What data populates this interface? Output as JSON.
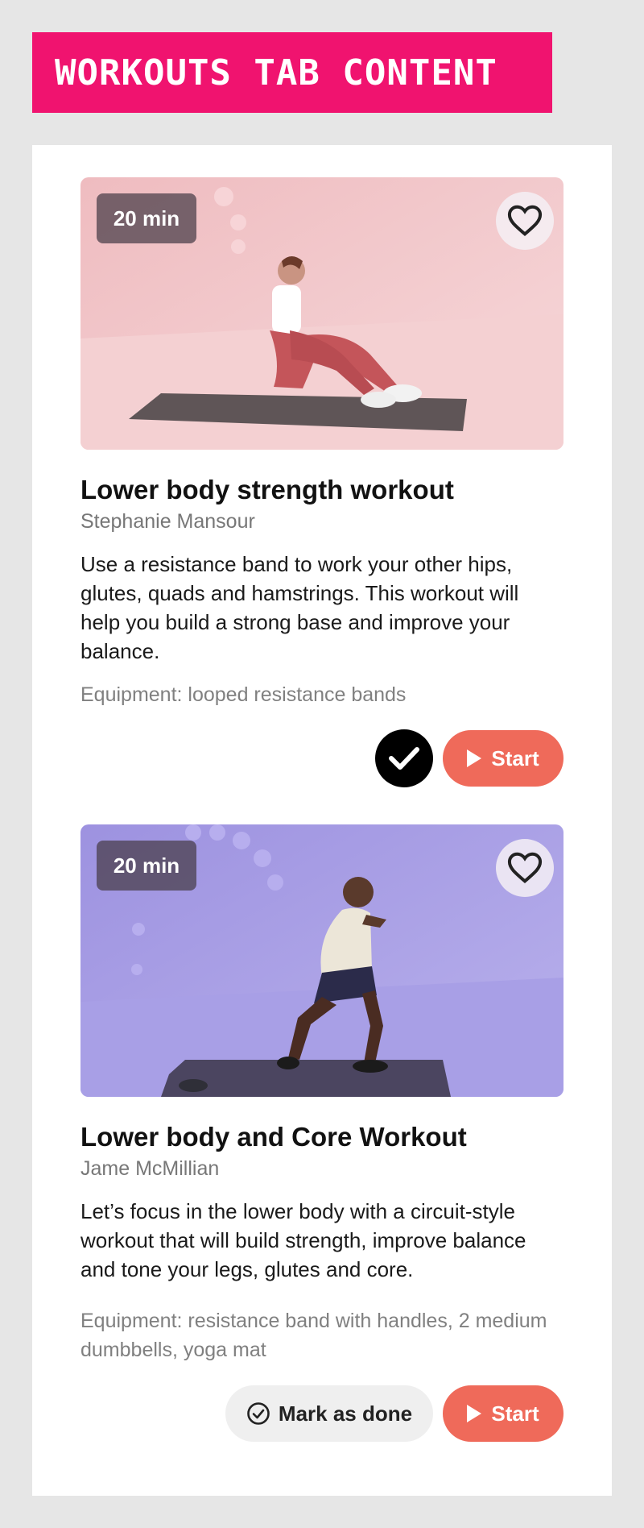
{
  "header": {
    "title": "WORKOUTS TAB CONTENT"
  },
  "workouts": [
    {
      "duration": "20 min",
      "title": "Lower body strength workout",
      "instructor": "Stephanie Mansour",
      "description": "Use a resistance band to work your other hips, glutes, quads and hamstrings. This workout will help you build a strong base and improve your balance.",
      "equipment": "Equipment: looped resistance bands",
      "completed": true,
      "start_label": "Start",
      "favorite_icon": "heart-outline-icon",
      "background_color": "#f3c9cc"
    },
    {
      "duration": "20 min",
      "title": "Lower body and Core Workout",
      "instructor": "Jame McMillian",
      "description": "Let’s focus in the lower body with a circuit-style workout that will build strength, improve balance and tone your legs, glutes and core.",
      "equipment": "Equipment: resistance band with handles, 2 medium dumbbells, yoga mat",
      "completed": false,
      "mark_done_label": "Mark as done",
      "start_label": "Start",
      "favorite_icon": "heart-outline-icon",
      "background_color": "#a59be3"
    }
  ],
  "colors": {
    "header_bg": "#f0136f",
    "start_button": "#ef6a5a",
    "page_bg": "#e6e6e6"
  }
}
